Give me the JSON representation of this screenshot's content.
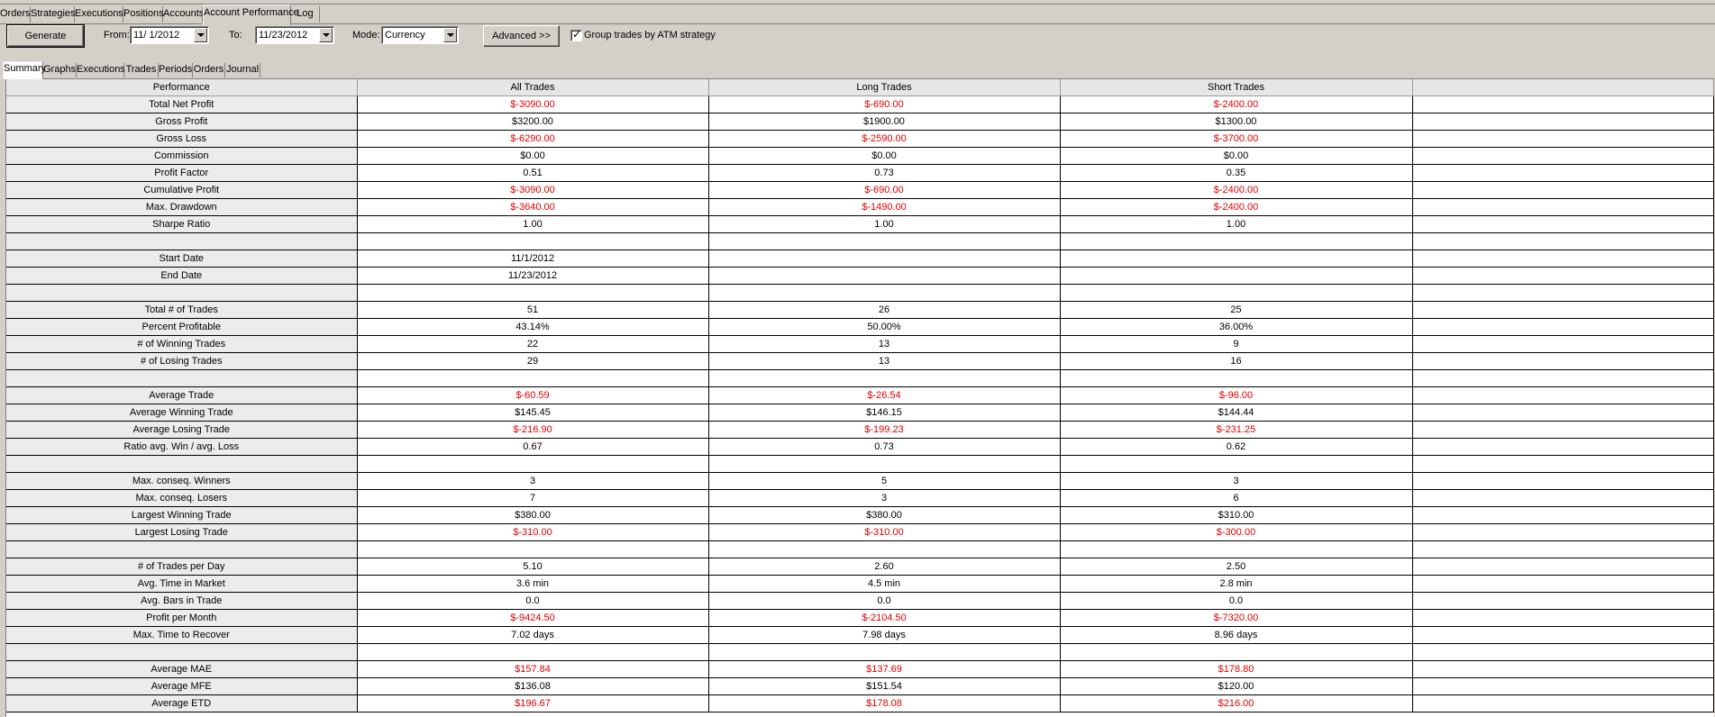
{
  "top_tabs": [
    "Orders",
    "Strategies",
    "Executions",
    "Positions",
    "Accounts",
    "Account Performance",
    "Log"
  ],
  "active_top_tab": 5,
  "toolbar": {
    "generate_label": "Generate",
    "from_label": "From:",
    "from_value": "11/ 1/2012",
    "to_label": "To:",
    "to_value": "11/23/2012",
    "mode_label": "Mode:",
    "mode_value": "Currency",
    "advanced_label": "Advanced >>",
    "group_label": "Group trades by ATM strategy",
    "group_checked": true
  },
  "sub_tabs": [
    "Summary",
    "Graphs",
    "Executions",
    "Trades",
    "Periods",
    "Orders",
    "Journal"
  ],
  "active_sub_tab": 0,
  "grid": {
    "columns": [
      "Performance",
      "All Trades",
      "Long Trades",
      "Short Trades"
    ],
    "negative_color": "#e00000",
    "rows": [
      {
        "name": "Total Net Profit",
        "all": "$-3090.00",
        "long": "$-690.00",
        "short": "$-2400.00",
        "neg": true
      },
      {
        "name": "Gross Profit",
        "all": "$3200.00",
        "long": "$1900.00",
        "short": "$1300.00",
        "neg": false
      },
      {
        "name": "Gross Loss",
        "all": "$-6290.00",
        "long": "$-2590.00",
        "short": "$-3700.00",
        "neg": true
      },
      {
        "name": "Commission",
        "all": "$0.00",
        "long": "$0.00",
        "short": "$0.00",
        "neg": false
      },
      {
        "name": "Profit Factor",
        "all": "0.51",
        "long": "0.73",
        "short": "0.35",
        "neg": false
      },
      {
        "name": "Cumulative Profit",
        "all": "$-3090.00",
        "long": "$-690.00",
        "short": "$-2400.00",
        "neg": true
      },
      {
        "name": "Max. Drawdown",
        "all": "$-3640.00",
        "long": "$-1490.00",
        "short": "$-2400.00",
        "neg": true
      },
      {
        "name": "Sharpe Ratio",
        "all": "1.00",
        "long": "1.00",
        "short": "1.00",
        "neg": false
      },
      {
        "name": "",
        "all": "",
        "long": "",
        "short": "",
        "neg": false
      },
      {
        "name": "Start Date",
        "all": "11/1/2012",
        "long": "",
        "short": "",
        "neg": false
      },
      {
        "name": "End Date",
        "all": "11/23/2012",
        "long": "",
        "short": "",
        "neg": false
      },
      {
        "name": "",
        "all": "",
        "long": "",
        "short": "",
        "neg": false
      },
      {
        "name": "Total # of Trades",
        "all": "51",
        "long": "26",
        "short": "25",
        "neg": false
      },
      {
        "name": "Percent Profitable",
        "all": "43.14%",
        "long": "50.00%",
        "short": "36.00%",
        "neg": false
      },
      {
        "name": "# of Winning Trades",
        "all": "22",
        "long": "13",
        "short": "9",
        "neg": false
      },
      {
        "name": "# of Losing Trades",
        "all": "29",
        "long": "13",
        "short": "16",
        "neg": false
      },
      {
        "name": "",
        "all": "",
        "long": "",
        "short": "",
        "neg": false
      },
      {
        "name": "Average Trade",
        "all": "$-60.59",
        "long": "$-26.54",
        "short": "$-96.00",
        "neg": true
      },
      {
        "name": "Average Winning Trade",
        "all": "$145.45",
        "long": "$146.15",
        "short": "$144.44",
        "neg": false
      },
      {
        "name": "Average Losing Trade",
        "all": "$-216.90",
        "long": "$-199.23",
        "short": "$-231.25",
        "neg": true
      },
      {
        "name": "Ratio avg. Win / avg. Loss",
        "all": "0.67",
        "long": "0.73",
        "short": "0.62",
        "neg": false
      },
      {
        "name": "",
        "all": "",
        "long": "",
        "short": "",
        "neg": false
      },
      {
        "name": "Max. conseq. Winners",
        "all": "3",
        "long": "5",
        "short": "3",
        "neg": false
      },
      {
        "name": "Max. conseq. Losers",
        "all": "7",
        "long": "3",
        "short": "6",
        "neg": false
      },
      {
        "name": "Largest Winning Trade",
        "all": "$380.00",
        "long": "$380.00",
        "short": "$310.00",
        "neg": false
      },
      {
        "name": "Largest Losing Trade",
        "all": "$-310.00",
        "long": "$-310.00",
        "short": "$-300.00",
        "neg": true
      },
      {
        "name": "",
        "all": "",
        "long": "",
        "short": "",
        "neg": false
      },
      {
        "name": "# of Trades per Day",
        "all": "5.10",
        "long": "2.60",
        "short": "2.50",
        "neg": false
      },
      {
        "name": "Avg. Time in Market",
        "all": "3.6 min",
        "long": "4.5 min",
        "short": "2.8 min",
        "neg": false
      },
      {
        "name": "Avg. Bars in Trade",
        "all": "0.0",
        "long": "0.0",
        "short": "0.0",
        "neg": false
      },
      {
        "name": "Profit per Month",
        "all": "$-9424.50",
        "long": "$-2104.50",
        "short": "$-7320.00",
        "neg": true
      },
      {
        "name": "Max. Time to Recover",
        "all": "7.02 days",
        "long": "7.98 days",
        "short": "8.96 days",
        "neg": false
      },
      {
        "name": "",
        "all": "",
        "long": "",
        "short": "",
        "neg": false
      },
      {
        "name": "Average MAE",
        "all": "$157.84",
        "long": "$137.69",
        "short": "$178.80",
        "neg": true
      },
      {
        "name": "Average MFE",
        "all": "$136.08",
        "long": "$151.54",
        "short": "$120.00",
        "neg": false
      },
      {
        "name": "Average ETD",
        "all": "$196.67",
        "long": "$178.08",
        "short": "$216.00",
        "neg": true
      }
    ]
  }
}
